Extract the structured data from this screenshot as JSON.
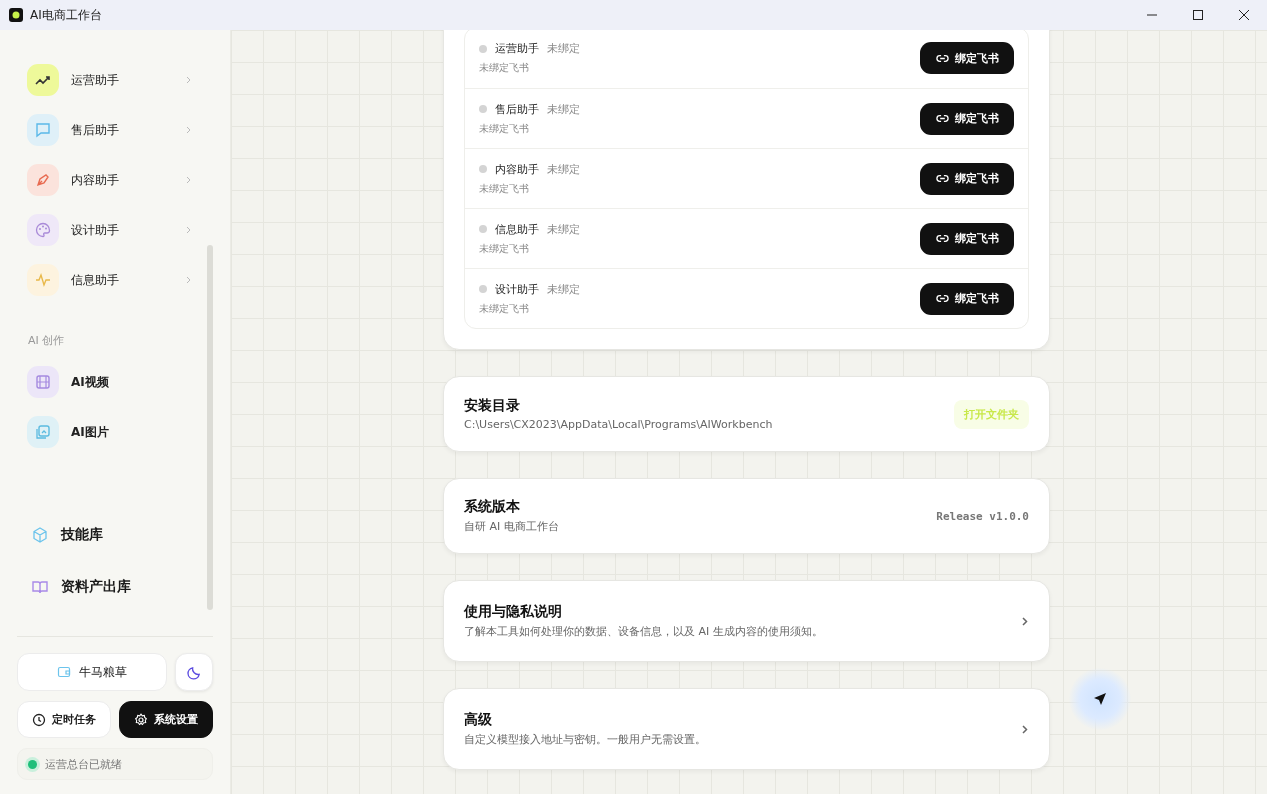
{
  "window": {
    "title": "AI电商工作台"
  },
  "sidebar": {
    "assistants": [
      {
        "label": "运营助手",
        "color": "#eef99a"
      },
      {
        "label": "售后助手",
        "color": "#dff0f8"
      },
      {
        "label": "内容助手",
        "color": "#fbe3dc"
      },
      {
        "label": "设计助手",
        "color": "#efe8f8"
      },
      {
        "label": "信息助手",
        "color": "#fdf3df"
      }
    ],
    "section_label": "AI 创作",
    "creation": [
      {
        "label": "AI视频",
        "color": "#ece6f8"
      },
      {
        "label": "AI图片",
        "color": "#dff1f6"
      }
    ],
    "libraries": [
      {
        "label": "技能库"
      },
      {
        "label": "资料产出库"
      }
    ],
    "supplies_button": "牛马粮草",
    "nav_buttons": [
      {
        "label": "定时任务",
        "selected": false
      },
      {
        "label": "系统设置",
        "selected": true
      }
    ],
    "status": {
      "text": "运营总台已就绪",
      "ready": true
    }
  },
  "bindings": [
    {
      "name": "运营助手",
      "status": "未绑定",
      "detail": "未绑定飞书",
      "bound": false,
      "button": "绑定飞书"
    },
    {
      "name": "售后助手",
      "status": "未绑定",
      "detail": "未绑定飞书",
      "bound": false,
      "button": "绑定飞书"
    },
    {
      "name": "内容助手",
      "status": "未绑定",
      "detail": "未绑定飞书",
      "bound": false,
      "button": "绑定飞书"
    },
    {
      "name": "信息助手",
      "status": "未绑定",
      "detail": "未绑定飞书",
      "bound": false,
      "button": "绑定飞书"
    },
    {
      "name": "设计助手",
      "status": "未绑定",
      "detail": "未绑定飞书",
      "bound": false,
      "button": "绑定飞书"
    }
  ],
  "cards": [
    {
      "kind": "path",
      "title": "安装目录",
      "subtitle": "C:\\Users\\CX2023\\AppData\\Local\\Programs\\AIWorkbench",
      "action": "打开文件夹"
    },
    {
      "kind": "version",
      "title": "系统版本",
      "subtitle": "自研 AI 电商工作台",
      "value": "Release v1.0.0"
    },
    {
      "kind": "link",
      "title": "使用与隐私说明",
      "subtitle": "了解本工具如何处理你的数据、设备信息，以及 AI 生成内容的使用须知。"
    },
    {
      "kind": "link",
      "title": "高级",
      "subtitle": "自定义模型接入地址与密钥。一般用户无需设置。"
    }
  ]
}
